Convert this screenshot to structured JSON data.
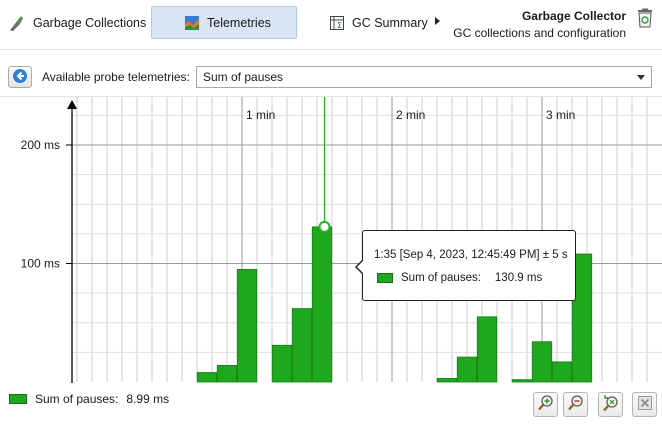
{
  "toolbar": {
    "tabs": [
      {
        "label": "Garbage Collections",
        "icon": "broom-icon"
      },
      {
        "label": "Telemetries",
        "icon": "telemetry-chart-icon",
        "active": true
      },
      {
        "label": "GC Summary",
        "icon": "summary-table-icon"
      }
    ],
    "more_icon": "chevron-right-icon",
    "view_title": "Garbage Collector",
    "view_subtitle": "GC collections and configuration",
    "trash_icon": "trash-icon"
  },
  "probe": {
    "label": "Available probe telemetries:",
    "selected": "Sum of pauses",
    "back_icon": "back-arrow-icon"
  },
  "chart_data": {
    "type": "bar",
    "series_color": "#1ea81e",
    "y_ticks": [
      "200 ms",
      "100 ms"
    ],
    "x_ticks": [
      "1 min",
      "2 min",
      "3 min"
    ],
    "ylim": [
      0,
      220
    ],
    "grid": true,
    "series": [
      {
        "name": "Sum of pauses",
        "bars": [
          {
            "t": 46,
            "v": 8
          },
          {
            "t": 54,
            "v": 14
          },
          {
            "t": 62,
            "v": 95
          },
          {
            "t": 76,
            "v": 31
          },
          {
            "t": 84,
            "v": 62
          },
          {
            "t": 92,
            "v": 130.9
          },
          {
            "t": 142,
            "v": 3
          },
          {
            "t": 150,
            "v": 21
          },
          {
            "t": 158,
            "v": 55
          },
          {
            "t": 172,
            "v": 2
          },
          {
            "t": 180,
            "v": 34
          },
          {
            "t": 188,
            "v": 17
          },
          {
            "t": 196,
            "v": 108
          }
        ]
      }
    ],
    "cursor_t": 93
  },
  "tooltip": {
    "time": "1:35 [Sep 4, 2023, 12:45:49 PM] ± 5 s",
    "series": "Sum of pauses:",
    "value": "130.9 ms"
  },
  "legend": {
    "series": "Sum of pauses:",
    "value": "8.99 ms"
  },
  "zoom": {
    "zoom_in_icon": "zoom-in-icon",
    "zoom_out_icon": "zoom-out-icon",
    "zoom_fit_icon": "zoom-fit-icon",
    "reset_icon": "close-icon"
  }
}
